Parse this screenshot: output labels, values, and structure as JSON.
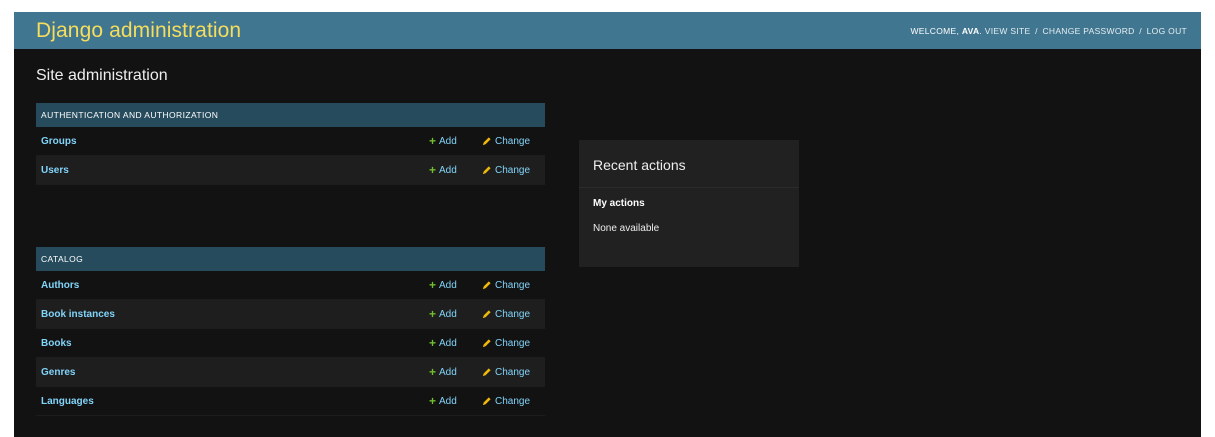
{
  "header": {
    "branding": "Django administration",
    "welcome": "WELCOME,",
    "username": "AVA",
    "view_site": "VIEW SITE",
    "change_password": "CHANGE PASSWORD",
    "log_out": "LOG OUT",
    "separator": "/"
  },
  "page_title": "Site administration",
  "modules": [
    {
      "caption": "AUTHENTICATION AND AUTHORIZATION",
      "models": [
        {
          "name": "Groups",
          "add": "Add",
          "change": "Change"
        },
        {
          "name": "Users",
          "add": "Add",
          "change": "Change"
        }
      ]
    },
    {
      "caption": "CATALOG",
      "models": [
        {
          "name": "Authors",
          "add": "Add",
          "change": "Change"
        },
        {
          "name": "Book instances",
          "add": "Add",
          "change": "Change"
        },
        {
          "name": "Books",
          "add": "Add",
          "change": "Change"
        },
        {
          "name": "Genres",
          "add": "Add",
          "change": "Change"
        },
        {
          "name": "Languages",
          "add": "Add",
          "change": "Change"
        }
      ]
    }
  ],
  "recent_actions": {
    "title": "Recent actions",
    "subtitle": "My actions",
    "empty": "None available"
  },
  "icons": {
    "add": "plus-icon",
    "change": "pencil-icon"
  },
  "colors": {
    "header_bg": "#417690",
    "branding": "#f5dd5d",
    "module_caption_bg": "#264b5d",
    "link": "#81d4fa",
    "add_icon": "#70bf2b",
    "change_icon": "#efb80b",
    "page_bg": "#121212"
  }
}
